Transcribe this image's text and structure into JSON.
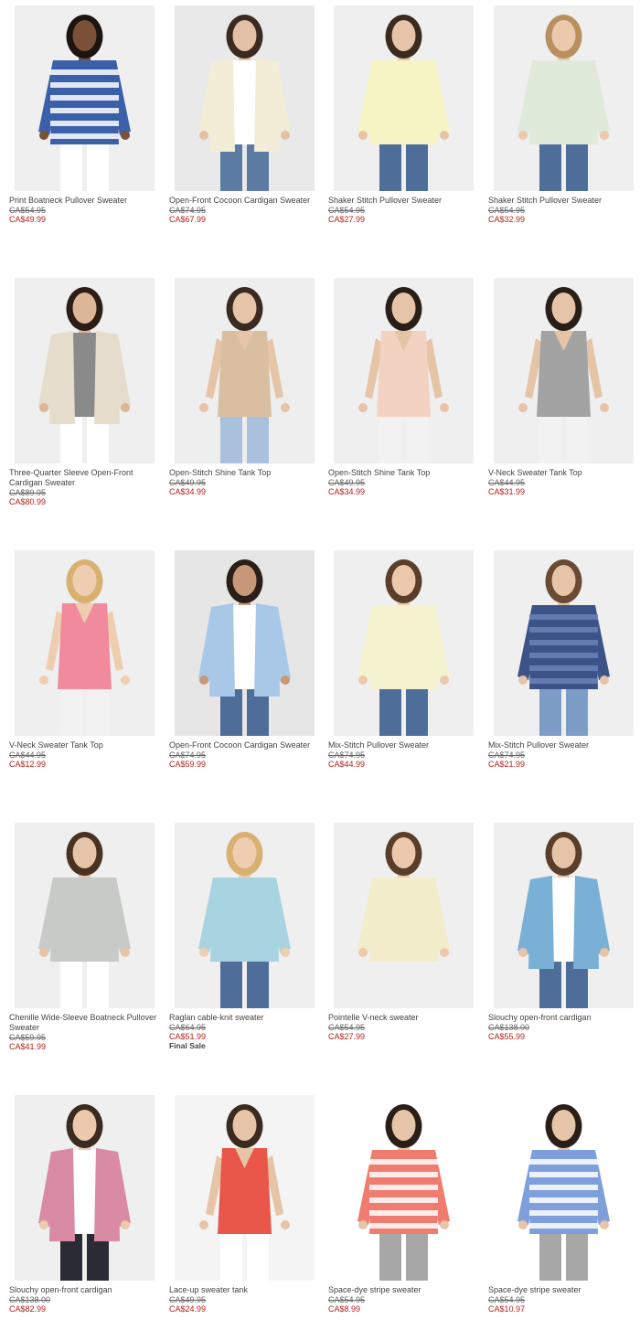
{
  "products": [
    {
      "name": "Print Boatneck Pullover Sweater",
      "was": "CA$54.95",
      "now": "CA$49.99",
      "bg": "#efefef",
      "top": "#3b5fa8",
      "top2": "#ffffff",
      "bottom": "#ffffff",
      "hair": "#1c1410",
      "skin": "#7a5038",
      "garment": "pullover-stripes"
    },
    {
      "name": "Open-Front Cocoon Cardigan Sweater",
      "was": "CA$74.95",
      "now": "CA$67.99",
      "bg": "#e9e9e9",
      "top": "#f3ecd6",
      "top2": "#ffffff",
      "bottom": "#5b7ba3",
      "hair": "#3a2a20",
      "skin": "#e2bfa5",
      "garment": "cardigan"
    },
    {
      "name": "Shaker Stitch Pullover Sweater",
      "was": "CA$54.95",
      "now": "CA$27.99",
      "bg": "#efefef",
      "top": "#f6f3c4",
      "top2": "#f6f3c4",
      "bottom": "#4f6d99",
      "hair": "#3b2a1e",
      "skin": "#e6c4aa",
      "garment": "pullover"
    },
    {
      "name": "Shaker Stitch Pullover Sweater",
      "was": "CA$54.95",
      "now": "CA$32.99",
      "bg": "#efefef",
      "top": "#dfeadb",
      "top2": "#dfeadb",
      "bottom": "#4f6d99",
      "hair": "#b89060",
      "skin": "#ecc9ad",
      "garment": "pullover"
    },
    {
      "name": "Three-Quarter Sleeve Open-Front Cardigan Sweater",
      "was": "CA$89.95",
      "now": "CA$80.99",
      "bg": "#efefef",
      "top": "#e6dccb",
      "top2": "#8a8a8a",
      "bottom": "#ffffff",
      "hair": "#2c1e16",
      "skin": "#dcb696",
      "garment": "cardigan"
    },
    {
      "name": "Open-Stitch Shine Tank Top",
      "was": "CA$49.95",
      "now": "CA$34.99",
      "bg": "#eeeeee",
      "top": "#d9bfa0",
      "top2": "#d9bfa0",
      "bottom": "#a9c1dd",
      "hair": "#3a2a20",
      "skin": "#e6c4a8",
      "garment": "tank"
    },
    {
      "name": "Open-Stitch Shine Tank Top",
      "was": "CA$49.95",
      "now": "CA$34.99",
      "bg": "#efefef",
      "top": "#f3d2c2",
      "top2": "#f3d2c2",
      "bottom": "#f2f2f2",
      "hair": "#2a1e18",
      "skin": "#e6c4a8",
      "garment": "tank"
    },
    {
      "name": "V-Neck Sweater Tank Top",
      "was": "CA$44.95",
      "now": "CA$31.99",
      "bg": "#efefef",
      "top": "#a3a3a3",
      "top2": "#ffffff",
      "bottom": "#f2f2f2",
      "hair": "#2a1e18",
      "skin": "#e6c4a8",
      "garment": "tank"
    },
    {
      "name": "V-Neck Sweater Tank Top",
      "was": "CA$44.95",
      "now": "CA$12.99",
      "bg": "#efefef",
      "top": "#f08a9c",
      "top2": "#f08a9c",
      "bottom": "#f2f2f2",
      "hair": "#d8b070",
      "skin": "#efcdb0",
      "garment": "tank"
    },
    {
      "name": "Open-Front Cocoon Cardigan Sweater",
      "was": "CA$74.95",
      "now": "CA$59.99",
      "bg": "#e6e6e6",
      "top": "#a9c8e8",
      "top2": "#ffffff",
      "bottom": "#4f6d99",
      "hair": "#2a1e18",
      "skin": "#c69878",
      "garment": "cardigan"
    },
    {
      "name": "Mix-Stitch Pullover Sweater",
      "was": "CA$74.95",
      "now": "CA$44.99",
      "bg": "#efefef",
      "top": "#f5f2cf",
      "top2": "#f5f2cf",
      "bottom": "#4f6d99",
      "hair": "#5a3e2a",
      "skin": "#ecc9ad",
      "garment": "pullover"
    },
    {
      "name": "Mix-Stitch Pullover Sweater",
      "was": "CA$74.95",
      "now": "CA$21.99",
      "bg": "#efefef",
      "top": "#3d5387",
      "top2": "#6a82b8",
      "bottom": "#7d9dc6",
      "hair": "#6a4a32",
      "skin": "#e6c4a8",
      "garment": "pullover-stripes"
    },
    {
      "name": "Chenille Wide-Sleeve Boatneck Pullover Sweater",
      "was": "CA$59.95",
      "now": "CA$41.99",
      "bg": "#efefef",
      "top": "#c7cac7",
      "top2": "#c7cac7",
      "bottom": "#ffffff",
      "hair": "#4a3222",
      "skin": "#e6c4a8",
      "garment": "pullover"
    },
    {
      "name": "Raglan cable-knit sweater",
      "was": "CA$64.95",
      "now": "CA$51.99",
      "badge": "Final Sale",
      "bg": "#efefef",
      "top": "#a8d4e2",
      "top2": "#a8d4e2",
      "bottom": "#4f6d99",
      "hair": "#d8b070",
      "skin": "#efcdb0",
      "garment": "pullover"
    },
    {
      "name": "Pointelle V-neck sweater",
      "was": "CA$54.95",
      "now": "CA$27.99",
      "bg": "#efefef",
      "top": "#f3ecca",
      "top2": "#f3ecca",
      "bottom": "#efefef",
      "hair": "#5a3e2a",
      "skin": "#ecc9ad",
      "garment": "pullover"
    },
    {
      "name": "Slouchy open-front cardigan",
      "was": "CA$138.00",
      "now": "CA$55.99",
      "bg": "#efefef",
      "top": "#7ab0d6",
      "top2": "#ffffff",
      "bottom": "#4f6d99",
      "hair": "#5a3e2a",
      "skin": "#e6c4a8",
      "garment": "cardigan"
    },
    {
      "name": "Slouchy open-front cardigan",
      "was": "CA$138.00",
      "now": "CA$82.99",
      "bg": "#efefef",
      "top": "#d98aa4",
      "top2": "#ffffff",
      "bottom": "#2b2b35",
      "hair": "#3a2a20",
      "skin": "#ecc9ad",
      "garment": "cardigan"
    },
    {
      "name": "Lace-up sweater tank",
      "was": "CA$49.95",
      "now": "CA$24.99",
      "bg": "#f4f4f4",
      "top": "#e8574a",
      "top2": "#e8574a",
      "bottom": "#ffffff",
      "hair": "#3a2a20",
      "skin": "#e6c4a8",
      "garment": "tank"
    },
    {
      "name": "Space-dye stripe sweater",
      "was": "CA$54.95",
      "now": "CA$8.99",
      "bg": "#ffffff",
      "top": "#ef7c6e",
      "top2": "#ffffff",
      "bottom": "#a7a7a7",
      "hair": "#2a1e18",
      "skin": "#e6c4a8",
      "garment": "pullover-stripes"
    },
    {
      "name": "Space-dye stripe sweater",
      "was": "CA$54.95",
      "now": "CA$10.97",
      "bg": "#ffffff",
      "top": "#7f9fdc",
      "top2": "#ffffff",
      "bottom": "#a7a7a7",
      "hair": "#2a1e18",
      "skin": "#e6c4a8",
      "garment": "pullover-stripes"
    }
  ]
}
